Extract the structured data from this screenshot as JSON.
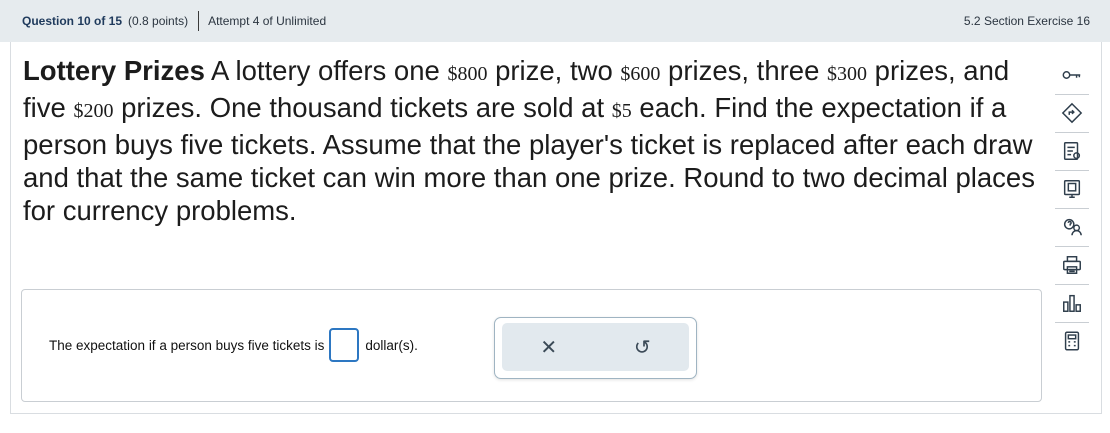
{
  "header": {
    "question_number": "Question 10 of 15",
    "points": "(0.8 points)",
    "attempt": "Attempt 4 of Unlimited",
    "section": "5.2 Section Exercise 16"
  },
  "question": {
    "title": "Lottery Prizes",
    "t1": " A lottery offers one ",
    "m1": "$800",
    "t2": " prize, two ",
    "m2": "$600",
    "t3": " prizes, three ",
    "m3": "$300",
    "t4": " prizes, and five ",
    "m4": "$200",
    "t5": " prizes. One thousand tickets are sold at ",
    "m5": "$5",
    "t6": " each. Find the expectation if a person buys five tickets. Assume that the player's ticket is replaced after each draw and that the same ticket can win more than one prize. Round to two decimal places for currency problems."
  },
  "answer": {
    "prompt": "The expectation if a person buys five tickets is",
    "unit": "dollar(s).",
    "value": ""
  },
  "tools": {
    "clear_symbol": "✕",
    "undo_symbol": "↺"
  },
  "sidebar_icons": [
    "key-icon",
    "hint-icon",
    "notes-icon",
    "whiteboard-icon",
    "ask-tutor-icon",
    "print-icon",
    "stats-icon",
    "calculator-icon"
  ],
  "colors": {
    "header_bg": "#e6ebee",
    "accent_blue": "#2d77c2",
    "title_blue": "#1f3a5c"
  }
}
